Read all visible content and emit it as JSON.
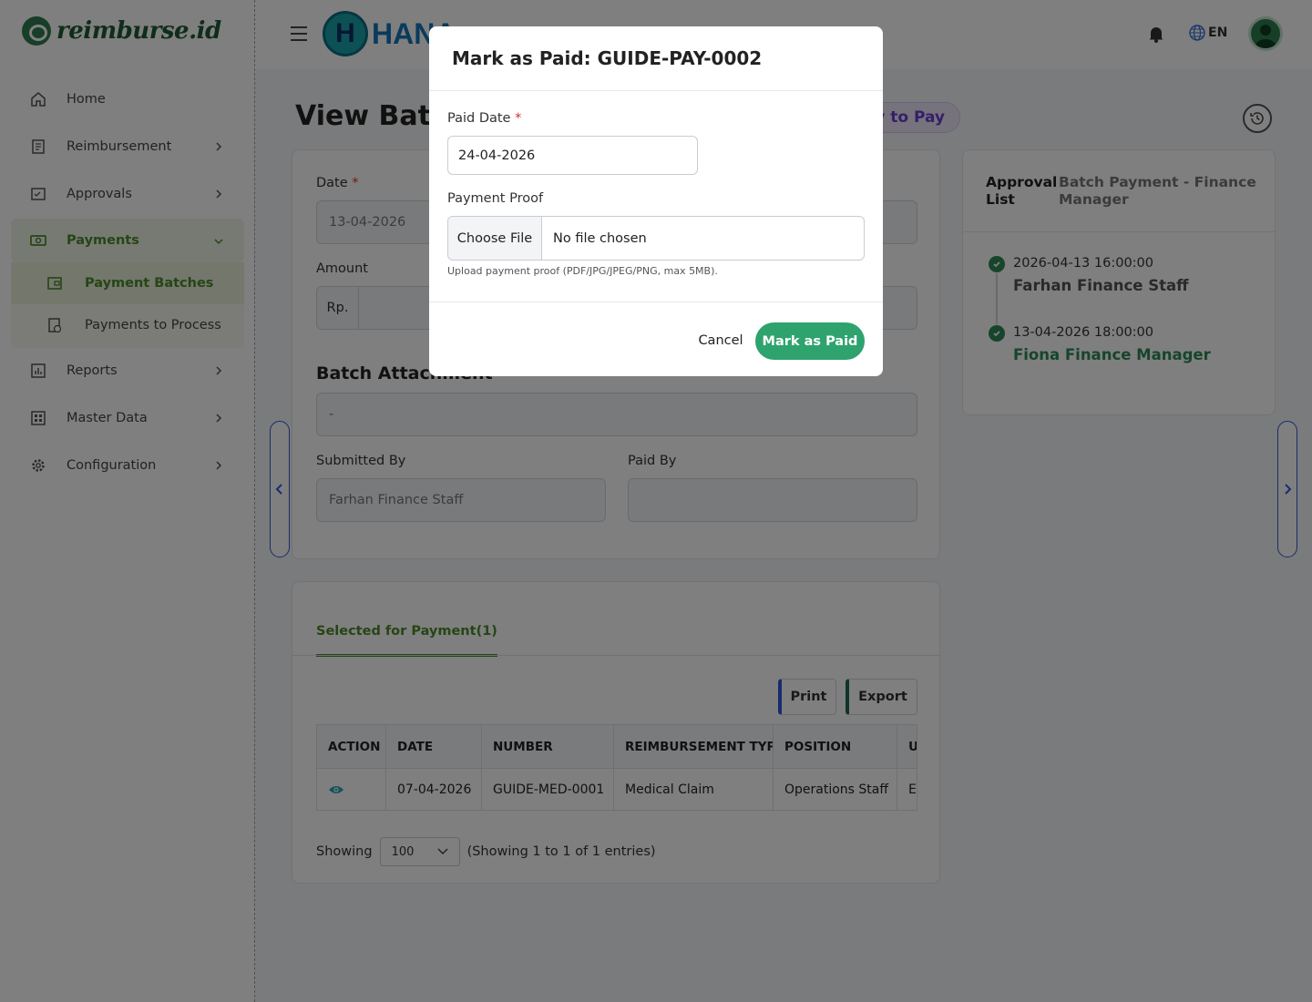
{
  "brand": {
    "name": "reimburse.id",
    "partner": "HANA"
  },
  "header": {
    "language": "EN"
  },
  "sidebar": {
    "items": [
      {
        "label": "Home"
      },
      {
        "label": "Reimbursement"
      },
      {
        "label": "Approvals"
      },
      {
        "label": "Payments"
      },
      {
        "label": "Reports"
      },
      {
        "label": "Master Data"
      },
      {
        "label": "Configuration"
      }
    ],
    "payments_sub": [
      {
        "label": "Payment Batches"
      },
      {
        "label": "Payments to Process"
      }
    ]
  },
  "page": {
    "title": "View Batc",
    "status": "y to Pay"
  },
  "form": {
    "date_label": "Date",
    "date_value": "13-04-2026",
    "amount_label": "Amount",
    "currency": "Rp.",
    "attachment_title": "Batch Attachment",
    "attachment_value": "-",
    "submitted_by_label": "Submitted By",
    "submitted_by_value": "Farhan Finance Staff",
    "paid_by_label": "Paid By",
    "paid_by_value": ""
  },
  "approval": {
    "title": "Approval List",
    "subtitle": "Batch Payment - Finance Manager",
    "entries": [
      {
        "time": "2026-04-13 16:00:00",
        "name": "Farhan Finance Staff"
      },
      {
        "time": "13-04-2026 18:00:00",
        "name": "Fiona Finance Manager"
      }
    ]
  },
  "table": {
    "tab_label": "Selected for Payment(1)",
    "print_label": "Print",
    "export_label": "Export",
    "columns": [
      "ACTION",
      "DATE",
      "NUMBER",
      "REIMBURSEMENT TYPE",
      "POSITION",
      "U"
    ],
    "rows": [
      {
        "date": "07-04-2026",
        "number": "GUIDE-MED-0001",
        "type": "Medical Claim",
        "position": "Operations Staff",
        "u": "El"
      }
    ],
    "showing_label": "Showing",
    "page_size": "100",
    "entries_text": "(Showing 1 to 1 of 1 entries)"
  },
  "modal": {
    "title": "Mark as Paid: GUIDE-PAY-0002",
    "paid_date_label": "Paid Date",
    "required_mark": "*",
    "paid_date_value": "24-04-2026",
    "proof_label": "Payment Proof",
    "choose_file": "Choose File",
    "no_file": "No file chosen",
    "hint": "Upload payment proof (PDF/JPG/JPEG/PNG, max 5MB).",
    "cancel": "Cancel",
    "submit": "Mark as Paid"
  },
  "colors": {
    "brand_green": "#2e7d4f",
    "accent_green": "#4c8a2a",
    "submit_green": "#2ea36d",
    "status_purple": "#6b3fd0"
  }
}
